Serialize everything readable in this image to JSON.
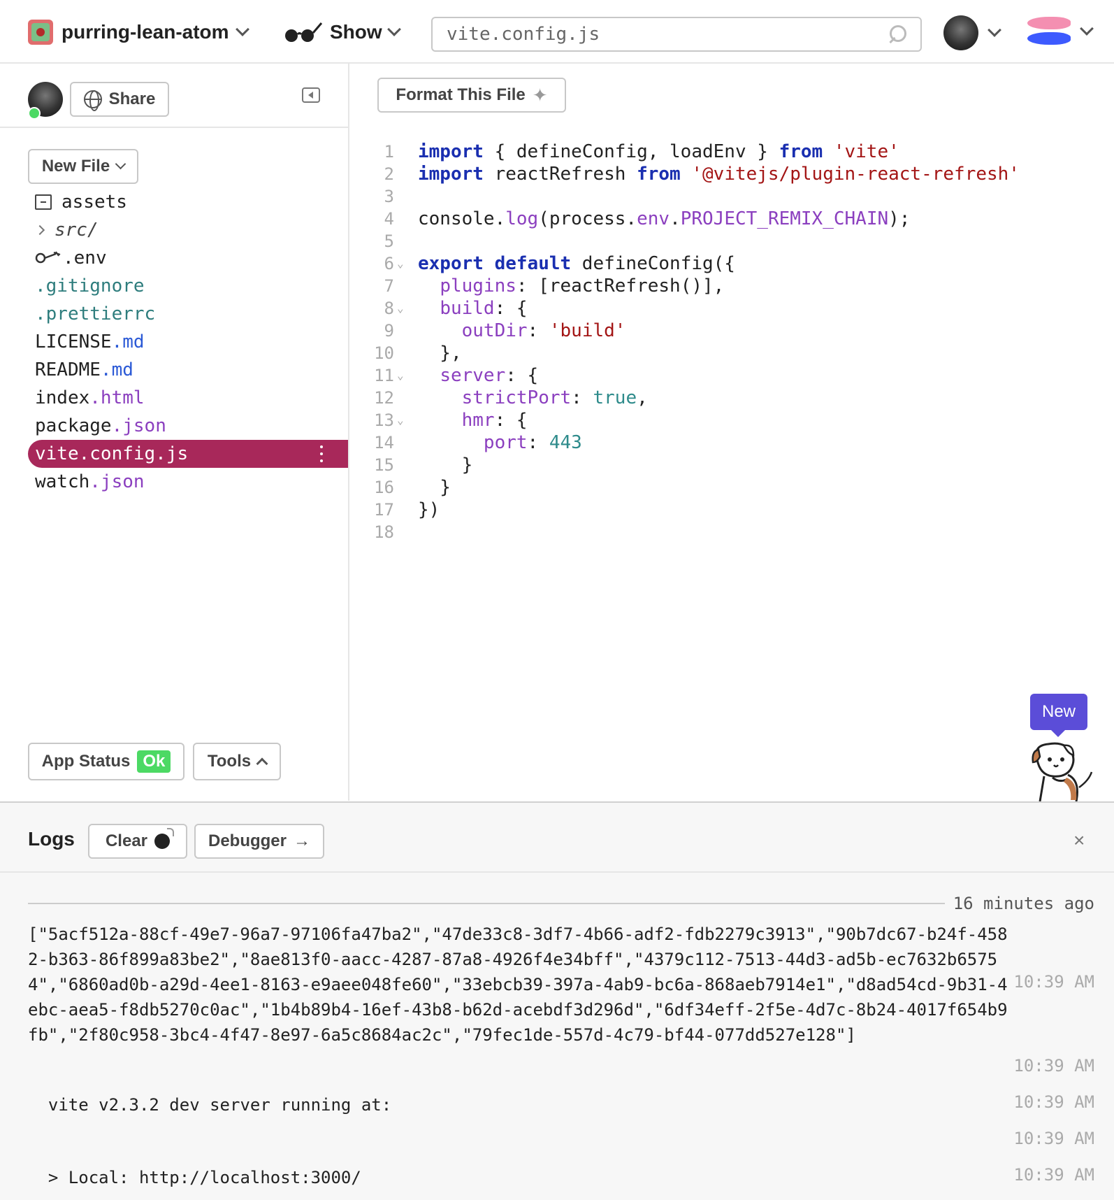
{
  "header": {
    "project_name": "purring-lean-atom",
    "show_label": "Show",
    "search_value": "vite.config.js"
  },
  "sidebar": {
    "share_label": "Share",
    "new_file_label": "New File",
    "files": {
      "assets": "assets",
      "src": "src/",
      "env": ".env",
      "gitignore_dot": ".",
      "gitignore_name": "gitignore",
      "prettierrc_dot": ".",
      "prettierrc_name": "prettierrc",
      "license_name": "LICENSE",
      "license_ext": ".md",
      "readme_name": "README",
      "readme_ext": ".md",
      "index_name": "index",
      "index_ext": ".html",
      "package_name": "package",
      "package_ext": ".json",
      "vite_name": "vite.config.js",
      "watch_name": "watch",
      "watch_ext": ".json"
    },
    "app_status_label": "App Status",
    "app_status_value": "Ok",
    "tools_label": "Tools"
  },
  "editor": {
    "format_label": "Format This File",
    "line_numbers": [
      "1",
      "2",
      "3",
      "4",
      "5",
      "6",
      "7",
      "8",
      "9",
      "10",
      "11",
      "12",
      "13",
      "14",
      "15",
      "16",
      "17",
      "18"
    ],
    "code": {
      "l1": {
        "kw1": "import",
        "a": " { defineConfig, loadEnv } ",
        "kw2": "from",
        "sp": " ",
        "str": "'vite'"
      },
      "l2": {
        "kw1": "import",
        "a": " reactRefresh ",
        "kw2": "from",
        "sp": " ",
        "str": "'@vitejs/plugin-react-refresh'"
      },
      "l4": {
        "a": "console.",
        "p1": "log",
        "b": "(process.",
        "p2": "env",
        "c": ".",
        "p3": "PROJECT_REMIX_CHAIN",
        "d": ");"
      },
      "l6": {
        "kw1": "export",
        "sp": " ",
        "kw2": "default",
        "a": " defineConfig({"
      },
      "l7": {
        "ind": "  ",
        "p": "plugins",
        "a": ": [reactRefresh()],"
      },
      "l8": {
        "ind": "  ",
        "p": "build",
        "a": ": {"
      },
      "l9": {
        "ind": "    ",
        "p": "outDir",
        "a": ": ",
        "str": "'build'"
      },
      "l10": {
        "a": "  },"
      },
      "l11": {
        "ind": "  ",
        "p": "server",
        "a": ": {"
      },
      "l12": {
        "ind": "    ",
        "p": "strictPort",
        "a": ": ",
        "b": "true",
        "c": ","
      },
      "l13": {
        "ind": "    ",
        "p": "hmr",
        "a": ": {"
      },
      "l14": {
        "ind": "      ",
        "p": "port",
        "a": ": ",
        "n": "443"
      },
      "l15": {
        "a": "    }"
      },
      "l16": {
        "a": "  }"
      },
      "l17": {
        "a": "})"
      }
    },
    "new_badge": "New"
  },
  "logs": {
    "title": "Logs",
    "clear_label": "Clear",
    "debugger_label": "Debugger",
    "debugger_arrow": "→",
    "close": "×",
    "separator_time": "16 minutes ago",
    "entries": [
      {
        "text": "[\"5acf512a-88cf-49e7-96a7-97106fa47ba2\",\"47de33c8-3df7-4b66-adf2-fdb2279c3913\",\"90b7dc67-b24f-4582-b363-86f899a83be2\",\"8ae813f0-aacc-4287-87a8-4926f4e34bff\",\"4379c112-7513-44d3-ad5b-ec7632b65754\",\"6860ad0b-a29d-4ee1-8163-e9aee048fe60\",\"33ebcb39-397a-4ab9-bc6a-868aeb7914e1\",\"d8ad54cd-9b31-4ebc-aea5-f8db5270c0ac\",\"1b4b89b4-16ef-43b8-b62d-acebdf3d296d\",\"6df34eff-2f5e-4d7c-8b24-4017f654b9fb\",\"2f80c958-3bc4-4f47-8e97-6a5c8684ac2c\",\"79fec1de-557d-4c79-bf44-077dd527e128\"]",
        "time": "10:39 AM"
      },
      {
        "text": "",
        "time": "10:39 AM"
      },
      {
        "text": "  vite v2.3.2 dev server running at:",
        "time": "10:39 AM"
      },
      {
        "text": "",
        "time": "10:39 AM"
      },
      {
        "text": "  > Local: http://localhost:3000/",
        "time": "10:39 AM"
      }
    ]
  }
}
